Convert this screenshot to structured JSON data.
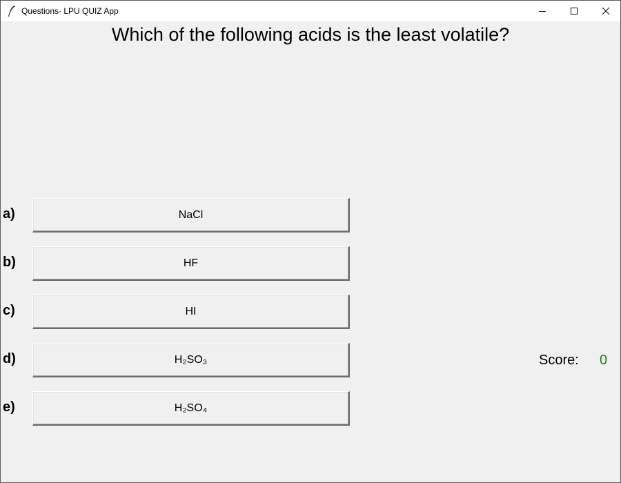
{
  "window": {
    "title": "Questions- LPU QUIZ App",
    "icon": "feather-icon"
  },
  "quiz": {
    "question": "Which of the following acids is the least volatile?",
    "options": [
      {
        "label": "a)",
        "text": "NaCl"
      },
      {
        "label": "b)",
        "text": "HF"
      },
      {
        "label": "c)",
        "text": "HI"
      },
      {
        "label": "d)",
        "text": "H₂SO₃"
      },
      {
        "label": "e)",
        "text": "H₂SO₄"
      }
    ]
  },
  "score": {
    "label": "Score:",
    "value": "0",
    "value_color": "#1a7a1a"
  }
}
